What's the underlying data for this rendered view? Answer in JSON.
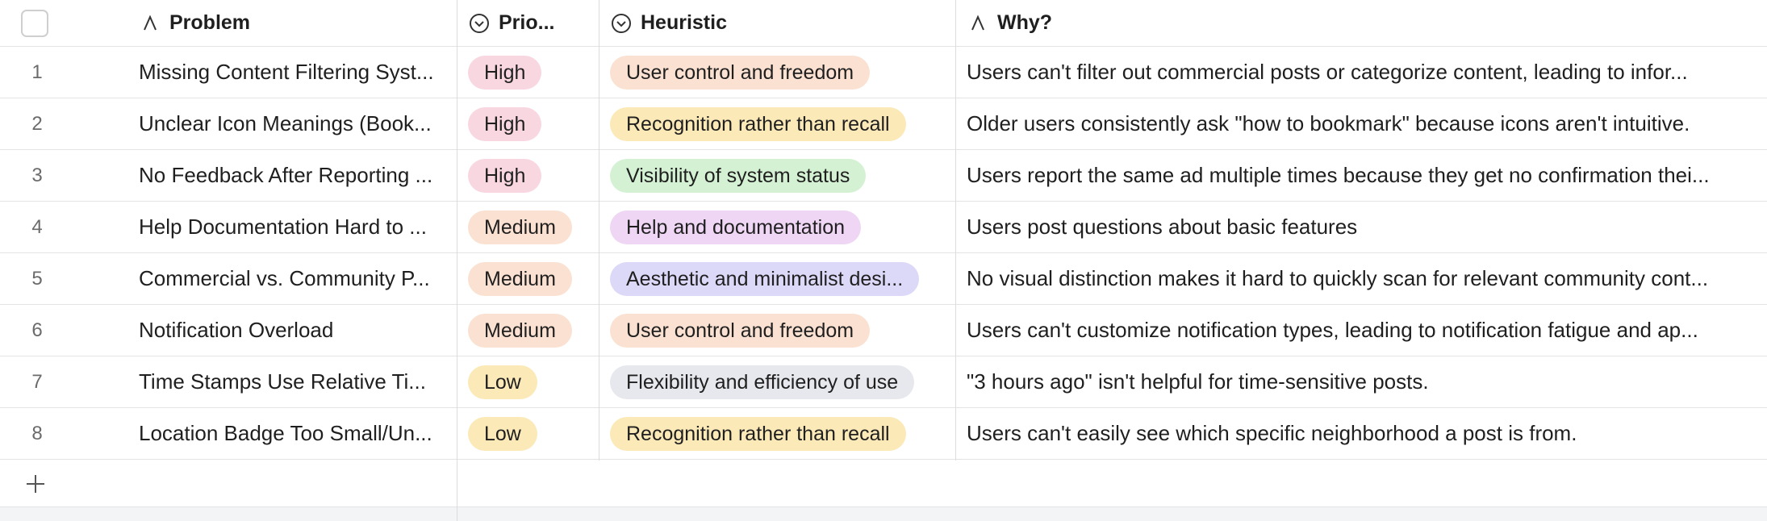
{
  "headers": {
    "problem": "Problem",
    "priority": "Prio...",
    "heuristic": "Heuristic",
    "why": "Why?"
  },
  "colors": {
    "pink": "#f9d7e1",
    "peach": "#fbe1d1",
    "yellow": "#fbe9b8",
    "green": "#d4f2d3",
    "purple": "#efd6f5",
    "lavender": "#dcd8f8",
    "gray": "#e7e8ed"
  },
  "rows": [
    {
      "num": "1",
      "problem": "Missing Content Filtering Syst...",
      "priority": "High",
      "priority_color": "pink",
      "heuristic": "User control and freedom",
      "heuristic_color": "peach",
      "why": "Users can't filter out commercial posts or categorize content, leading to infor..."
    },
    {
      "num": "2",
      "problem": "Unclear Icon Meanings (Book...",
      "priority": "High",
      "priority_color": "pink",
      "heuristic": "Recognition rather than recall",
      "heuristic_color": "yellow",
      "why": "Older users consistently ask \"how to bookmark\" because icons aren't intuitive."
    },
    {
      "num": "3",
      "problem": "No Feedback After Reporting ...",
      "priority": "High",
      "priority_color": "pink",
      "heuristic": "Visibility of system status",
      "heuristic_color": "green",
      "why": "Users report the same ad multiple times because they get no confirmation thei..."
    },
    {
      "num": "4",
      "problem": "Help Documentation Hard to ...",
      "priority": "Medium",
      "priority_color": "peach",
      "heuristic": "Help and documentation",
      "heuristic_color": "purple",
      "why": "Users post questions about basic features"
    },
    {
      "num": "5",
      "problem": "Commercial vs. Community P...",
      "priority": "Medium",
      "priority_color": "peach",
      "heuristic": "Aesthetic and minimalist desi...",
      "heuristic_color": "lavender",
      "why": "No visual distinction makes it hard to quickly scan for relevant community cont..."
    },
    {
      "num": "6",
      "problem": "Notification Overload",
      "priority": "Medium",
      "priority_color": "peach",
      "heuristic": "User control and freedom",
      "heuristic_color": "peach",
      "why": "Users can't customize notification types, leading to notification fatigue and ap..."
    },
    {
      "num": "7",
      "problem": "Time Stamps Use Relative Ti...",
      "priority": "Low",
      "priority_color": "yellow",
      "heuristic": "Flexibility and efficiency of use",
      "heuristic_color": "gray",
      "why": "\"3 hours ago\" isn't helpful for time-sensitive posts."
    },
    {
      "num": "8",
      "problem": "Location Badge Too Small/Un...",
      "priority": "Low",
      "priority_color": "yellow",
      "heuristic": "Recognition rather than recall",
      "heuristic_color": "yellow",
      "why": "Users can't easily see which specific neighborhood a post is from."
    }
  ],
  "icons": {
    "add_row": "plus-icon",
    "text_field": "text-field-icon",
    "select_field": "single-select-icon"
  }
}
